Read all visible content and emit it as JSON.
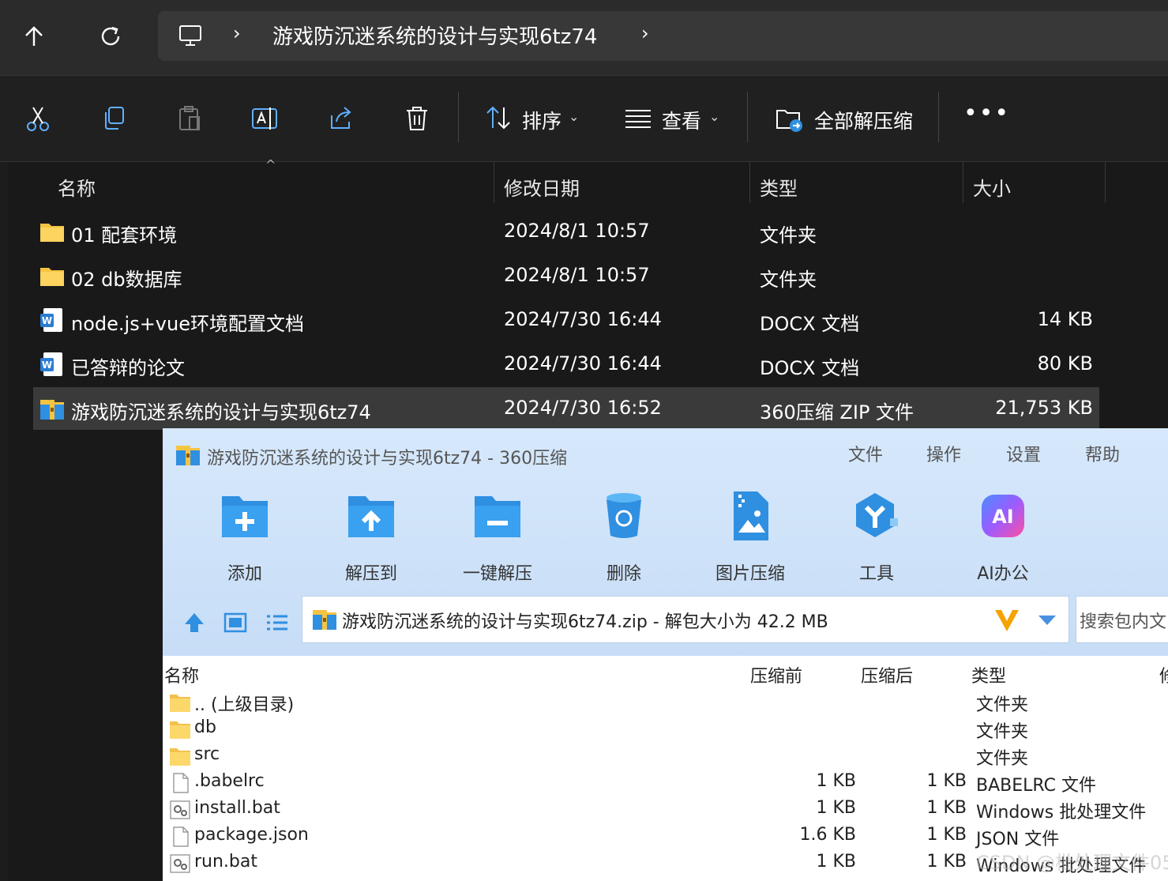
{
  "explorer": {
    "address": {
      "path": "游戏防沉迷系统的设计与实现6tz74"
    },
    "toolbar": {
      "sort_label": "排序",
      "view_label": "查看",
      "extract_all_label": "全部解压缩"
    },
    "columns": {
      "name": "名称",
      "date": "修改日期",
      "type": "类型",
      "size": "大小"
    },
    "files": [
      {
        "name": "01 配套环境",
        "date": "2024/8/1 10:57",
        "type": "文件夹",
        "size": "",
        "icon": "folder-icon"
      },
      {
        "name": "02 db数据库",
        "date": "2024/8/1 10:57",
        "type": "文件夹",
        "size": "",
        "icon": "folder-icon"
      },
      {
        "name": "node.js+vue环境配置文档",
        "date": "2024/7/30 16:44",
        "type": "DOCX 文档",
        "size": "14 KB",
        "icon": "word-doc-icon"
      },
      {
        "name": "已答辩的论文",
        "date": "2024/7/30 16:44",
        "type": "DOCX 文档",
        "size": "80 KB",
        "icon": "word-doc-icon"
      },
      {
        "name": "游戏防沉迷系统的设计与实现6tz74",
        "date": "2024/7/30 16:52",
        "type": "360压缩 ZIP 文件",
        "size": "21,753 KB",
        "icon": "zip-archive-icon"
      }
    ]
  },
  "zip_window": {
    "title": "游戏防沉迷系统的设计与实现6tz74 - 360压缩",
    "menu": {
      "file": "文件",
      "action": "操作",
      "settings": "设置",
      "help": "帮助"
    },
    "tools": {
      "add": "添加",
      "extract_to": "解压到",
      "one_click_extract": "一键解压",
      "delete": "删除",
      "image_compress": "图片压缩",
      "tools": "工具",
      "ai_office": "AI办公"
    },
    "path": "游戏防沉迷系统的设计与实现6tz74.zip - 解包大小为 42.2 MB",
    "search_placeholder": "搜索包内文",
    "columns": {
      "name": "名称",
      "before": "压缩前",
      "after": "压缩后",
      "type": "类型",
      "extra": "修"
    },
    "items": [
      {
        "name": ".. (上级目录)",
        "before": "",
        "after": "",
        "type": "文件夹",
        "icon": "folder-icon"
      },
      {
        "name": "db",
        "before": "",
        "after": "",
        "type": "文件夹",
        "icon": "folder-icon"
      },
      {
        "name": "src",
        "before": "",
        "after": "",
        "type": "文件夹",
        "icon": "folder-icon"
      },
      {
        "name": ".babelrc",
        "before": "1 KB",
        "after": "1 KB",
        "type": "BABELRC 文件",
        "icon": "blank-file-icon"
      },
      {
        "name": "install.bat",
        "before": "1 KB",
        "after": "1 KB",
        "type": "Windows 批处理文件",
        "icon": "batch-file-icon"
      },
      {
        "name": "package.json",
        "before": "1.6 KB",
        "after": "1 KB",
        "type": "JSON 文件",
        "icon": "blank-file-icon"
      },
      {
        "name": "run.bat",
        "before": "1 KB",
        "after": "1 KB",
        "type": "Windows 批处理文件",
        "icon": "batch-file-icon"
      }
    ]
  },
  "watermark": "CSDN @枇处理文件05",
  "colors": {
    "explorer_bg": "#1c1c1c",
    "selected_row": "#3a3a3a",
    "folder_yellow": "#f6c443",
    "zip_blue": "#2f8fe0"
  }
}
